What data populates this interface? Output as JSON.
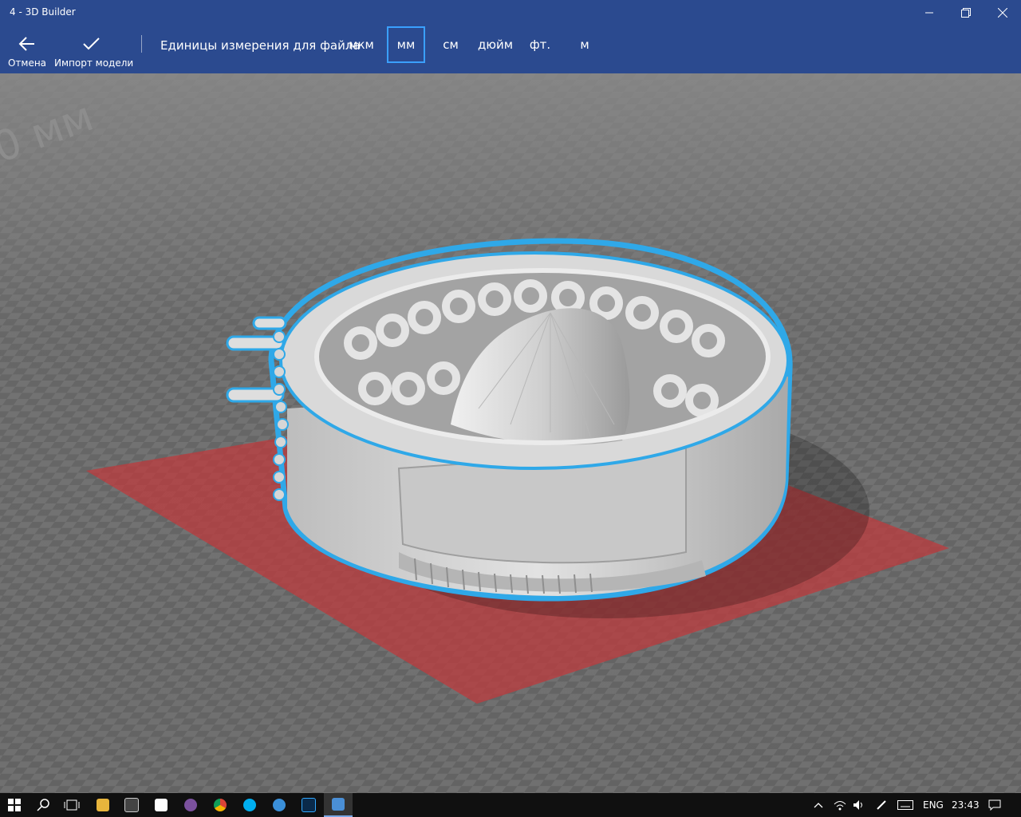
{
  "window": {
    "title": "4 - 3D Builder"
  },
  "commandbar": {
    "cancel_label": "Отмена",
    "import_label": "Импорт модели",
    "units_label": "Единицы измерения для файла",
    "units": [
      "мкм",
      "мм",
      "см",
      "дюйм",
      "фт.",
      "м"
    ],
    "selected_unit": "мм"
  },
  "viewport": {
    "floor_text": "0 мм",
    "accent_color": "#2fa8e8",
    "plate_color": "#c0393b",
    "model_color": "#d8d8d8"
  },
  "taskbar": {
    "language": "ENG",
    "time": "23:43",
    "apps": [
      "start-icon",
      "search-icon",
      "task-view-icon",
      "file-explorer-icon",
      "calculator-icon",
      "store-icon",
      "viber-icon",
      "chrome-icon",
      "skype-icon",
      "app-icon",
      "photoshop-icon",
      "3d-builder-icon"
    ]
  }
}
